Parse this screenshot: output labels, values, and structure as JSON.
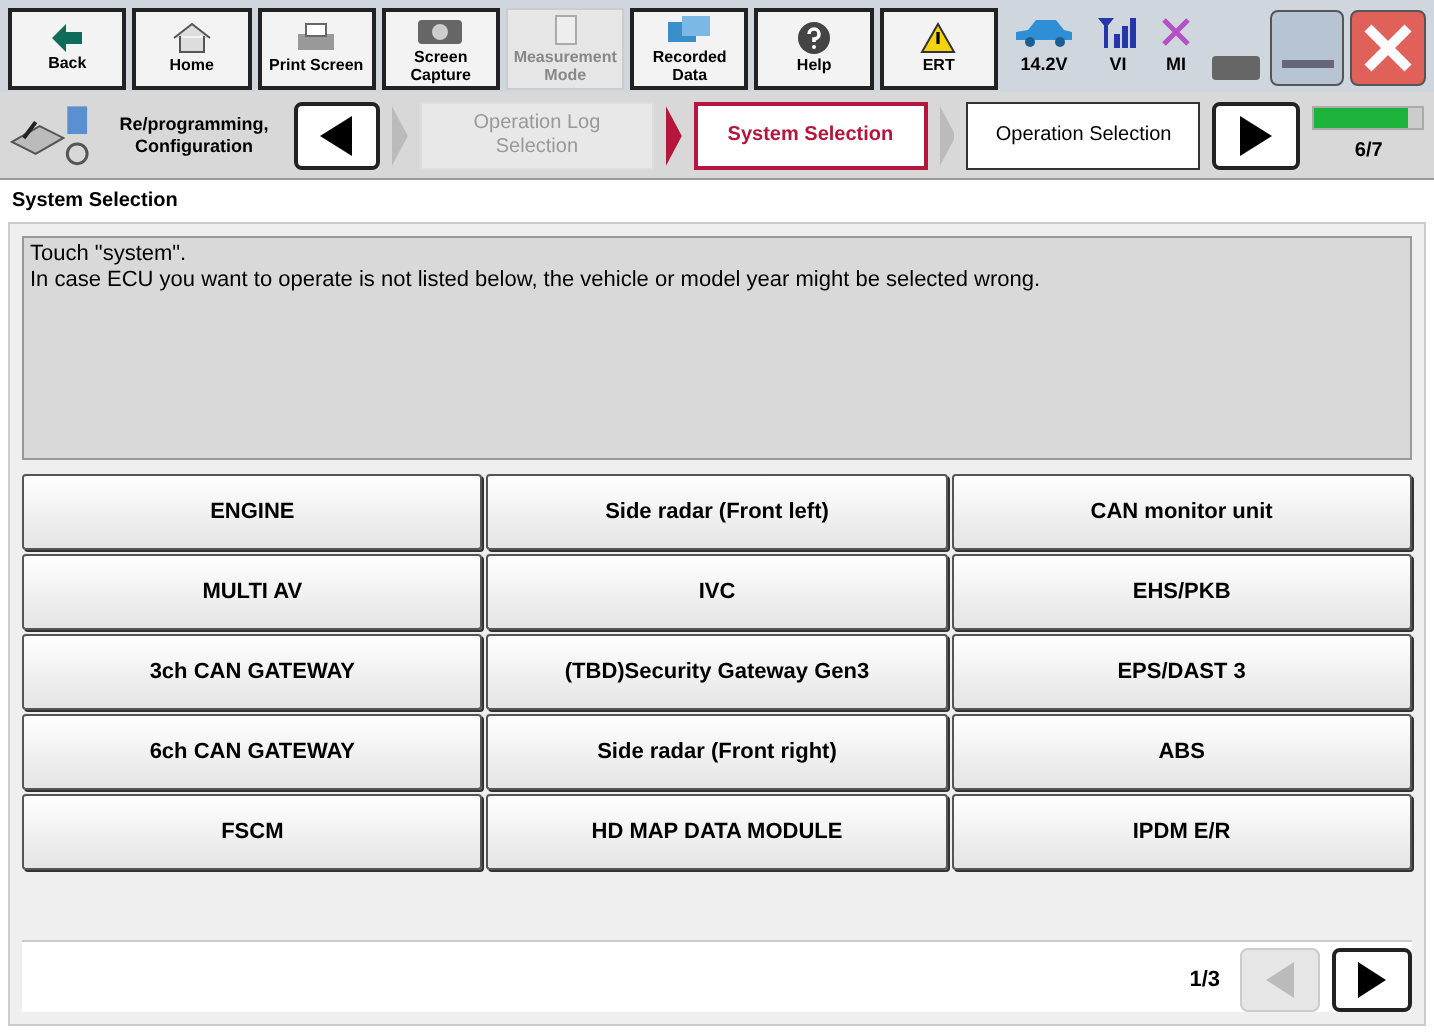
{
  "toolbar": [
    {
      "label": "Back",
      "kind": "back",
      "disabled": false
    },
    {
      "label": "Home",
      "kind": "home",
      "disabled": false
    },
    {
      "label": "Print Screen",
      "kind": "print",
      "disabled": false
    },
    {
      "label": "Screen Capture",
      "kind": "camera",
      "disabled": false
    },
    {
      "label": "Measurement Mode",
      "kind": "meter",
      "disabled": true
    },
    {
      "label": "Recorded Data",
      "kind": "data",
      "disabled": false
    },
    {
      "label": "Help",
      "kind": "help",
      "disabled": false
    },
    {
      "label": "ERT",
      "kind": "warning",
      "disabled": false
    }
  ],
  "status": [
    {
      "label": "14.2V",
      "kind": "car"
    },
    {
      "label": "VI",
      "kind": "signal"
    },
    {
      "label": "MI",
      "kind": "cross"
    },
    {
      "kind": "battery"
    }
  ],
  "breadcrumb": {
    "mode": "Re/programming, Configuration",
    "steps": [
      {
        "label": "Operation Log Selection",
        "disabled": true,
        "selected": false
      },
      {
        "label": "System Selection",
        "disabled": false,
        "selected": true
      },
      {
        "label": "Operation Selection",
        "disabled": false,
        "selected": false
      }
    ],
    "progress": {
      "level": 0.86,
      "label": "6/7"
    }
  },
  "page_title": "System Selection",
  "message": [
    "Touch \"system\".",
    "In case ECU you want to operate is not listed below, the vehicle or model year might be selected wrong."
  ],
  "systems": [
    "ENGINE",
    "Side radar (Front left)",
    "CAN monitor unit",
    "MULTI AV",
    "IVC",
    "EHS/PKB",
    "3ch CAN GATEWAY",
    "(TBD)Security Gateway Gen3",
    "EPS/DAST 3",
    "6ch CAN GATEWAY",
    "Side radar (Front right)",
    "ABS",
    "FSCM",
    "HD MAP DATA MODULE",
    "IPDM E/R"
  ],
  "pager": {
    "label": "1/3",
    "prev_disabled": true,
    "next_disabled": false
  }
}
